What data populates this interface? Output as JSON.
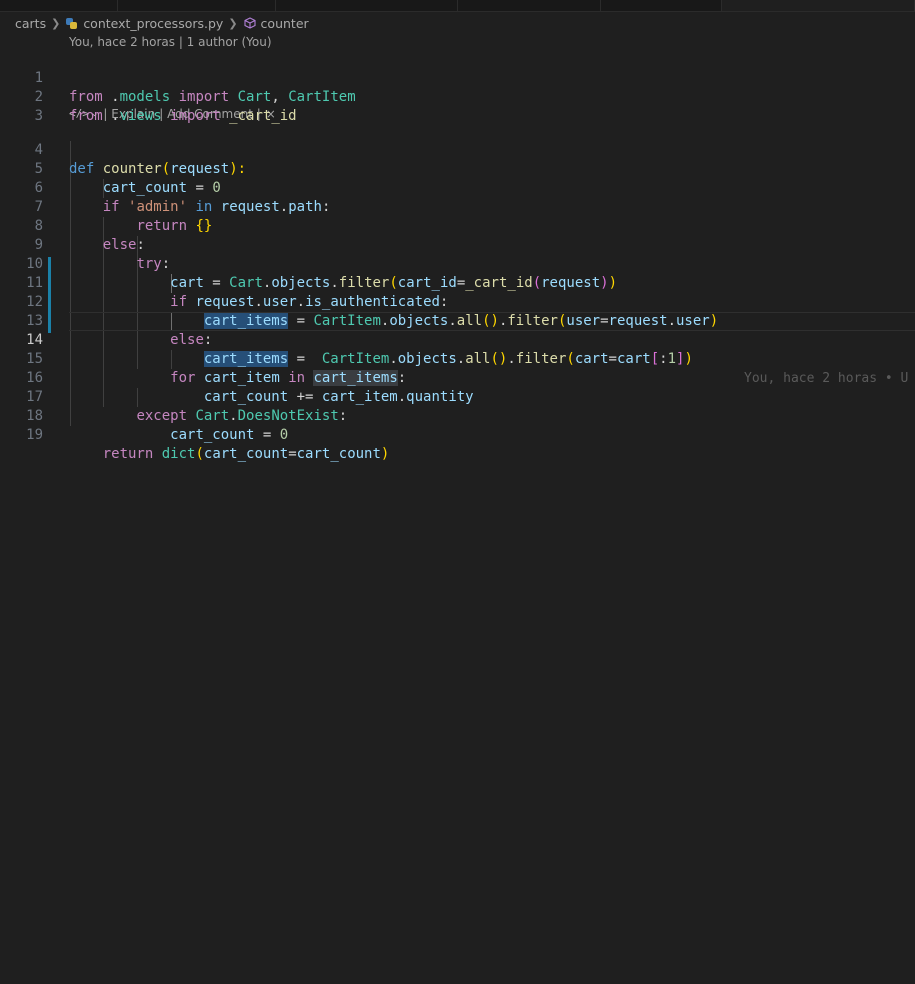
{
  "breadcrumb": {
    "folder": "carts",
    "file": "context_processors.py",
    "symbol": "counter"
  },
  "blame": {
    "author_line": "You, hace 2 horas | 1 author (You)"
  },
  "codelens": {
    "explain": "| Explain",
    "add_comment": "| Add Comment |",
    "close": "×"
  },
  "ghost_blame": "You, hace 2 horas • U",
  "line_numbers": [
    "1",
    "2",
    "3",
    "4",
    "5",
    "6",
    "7",
    "8",
    "9",
    "10",
    "11",
    "12",
    "13",
    "14",
    "15",
    "16",
    "17",
    "18",
    "19"
  ],
  "code": {
    "l1": [
      "from",
      " .",
      "models",
      " ",
      "import",
      " ",
      "Cart",
      ", ",
      "CartItem"
    ],
    "l2": [
      "from",
      " .",
      "views",
      " ",
      "import",
      " _cart_id"
    ],
    "l4": [
      "def",
      " ",
      "counter",
      "(",
      "request",
      "):"
    ],
    "l5": [
      "cart_count",
      " = ",
      "0"
    ],
    "l6": [
      "if",
      " ",
      "'admin'",
      " ",
      "in",
      " ",
      "request",
      ".",
      "path",
      ":"
    ],
    "l7": [
      "return",
      " ",
      "{}"
    ],
    "l8": [
      "else",
      ":"
    ],
    "l9": [
      "try",
      ":"
    ],
    "l10": [
      "cart",
      " = ",
      "Cart",
      ".",
      "objects",
      ".",
      "filter",
      "(",
      "cart_id",
      "=",
      "_cart_id",
      "(",
      "request",
      ")",
      ")"
    ],
    "l11": [
      "if",
      " ",
      "request",
      ".",
      "user",
      ".",
      "is_authenticated",
      ":"
    ],
    "l12": [
      "cart_items",
      " = ",
      "CartItem",
      ".",
      "objects",
      ".",
      "all",
      "()",
      ".",
      "filter",
      "(",
      "user",
      "=",
      "request",
      ".",
      "user",
      ")"
    ],
    "l13": [
      "else",
      ":"
    ],
    "l14": [
      "cart_items",
      " =  ",
      "CartItem",
      ".",
      "objects",
      ".",
      "all",
      "()",
      ".",
      "filter",
      "(",
      "cart",
      "=",
      "cart",
      "[",
      ":",
      "1",
      "]",
      ")"
    ],
    "l15": [
      "for",
      " ",
      "cart_item",
      " ",
      "in",
      " ",
      "cart_items",
      ":"
    ],
    "l16": [
      "cart_count",
      " += ",
      "cart_item",
      ".",
      "quantity"
    ],
    "l17": [
      "except",
      " ",
      "Cart",
      ".",
      "DoesNotExist",
      ":"
    ],
    "l18": [
      "cart_count",
      " = ",
      "0"
    ],
    "l19": [
      "return",
      " ",
      "dict",
      "(",
      "cart_count",
      "=",
      "cart_count",
      ")"
    ]
  }
}
